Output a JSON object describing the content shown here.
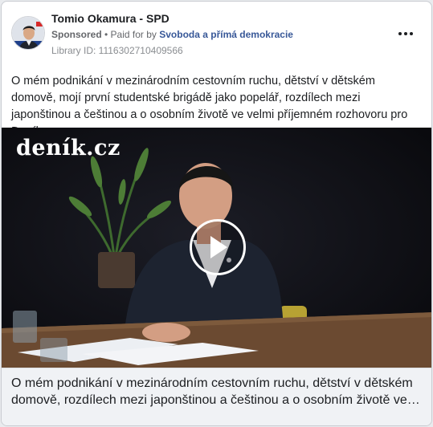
{
  "post": {
    "page_name": "Tomio Okamura - SPD",
    "sponsored": "Sponsored",
    "separator": " • ",
    "paid_for_prefix": "Paid for by ",
    "paid_for_by": "Svoboda a přímá demokracie",
    "library_id": "Library ID: 1116302710409566",
    "body": "O mém podnikání v mezinárodním cestovním ruchu, dětství v dětském domově, mojí první studentské brigádě jako popelář, rozdílech mezi japonštinou a češtinou a o osobním životě ve velmi příjemném rozhovoru pro Deník."
  },
  "video": {
    "watermark": "deník.cz"
  },
  "caption": {
    "text": "O mém podnikání v mezinárodním cestovním ruchu, dětství v dětském domově, rozdílech mezi japonštinou a češtinou a o osobním životě ve…"
  },
  "icons": {
    "more": "more-options-icon",
    "play": "play-icon",
    "avatar": "profile-picture"
  }
}
